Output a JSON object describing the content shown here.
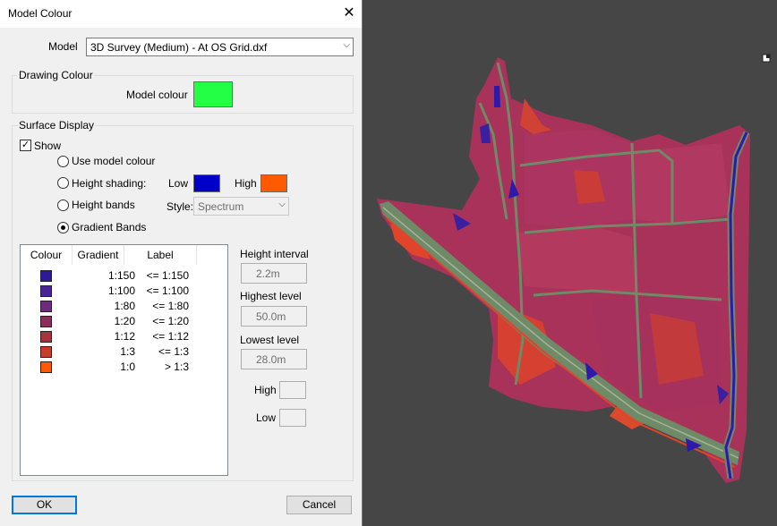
{
  "dialog": {
    "title": "Model Colour",
    "model_label": "Model",
    "model_value": "3D Survey (Medium) - At OS Grid.dxf",
    "drawing_colour": {
      "group_title": "Drawing Colour",
      "model_colour_label": "Model colour",
      "model_colour": "#22ff44"
    },
    "surface_display": {
      "group_title": "Surface Display",
      "show_label": "Show",
      "show_checked": true,
      "options": {
        "use_model_colour": "Use model colour",
        "height_shading": "Height shading:",
        "height_bands": "Height bands",
        "gradient_bands": "Gradient Bands"
      },
      "selected_option": "gradient_bands",
      "low_label": "Low",
      "low_colour": "#0000c8",
      "high_label": "High",
      "high_colour": "#ff5a00",
      "style_label": "Style:",
      "style_value": "Spectrum"
    },
    "gradient_table": {
      "headers": {
        "colour": "Colour",
        "gradient": "Gradient",
        "label": "Label"
      },
      "rows": [
        {
          "colour": "#2e1a96",
          "gradient": "1:150",
          "label": "<= 1:150"
        },
        {
          "colour": "#4a2496",
          "gradient": "1:100",
          "label": "<= 1:100"
        },
        {
          "colour": "#6e2a7c",
          "gradient": "1:80",
          "label": "<= 1:80"
        },
        {
          "colour": "#8c2e5c",
          "gradient": "1:20",
          "label": "<= 1:20"
        },
        {
          "colour": "#a8323e",
          "gradient": "1:12",
          "label": "<= 1:12"
        },
        {
          "colour": "#c83c2a",
          "gradient": "1:3",
          "label": "<= 1:3"
        },
        {
          "colour": "#ff5a00",
          "gradient": "1:0",
          "label": "> 1:3"
        }
      ]
    },
    "height_interval_label": "Height interval",
    "height_interval_value": "2.2m",
    "highest_level_label": "Highest level",
    "highest_level_value": "50.0m",
    "lowest_level_label": "Lowest level",
    "lowest_level_value": "28.0m",
    "high_label": "High",
    "low_label": "Low",
    "ok_label": "OK",
    "cancel_label": "Cancel"
  },
  "viewport": {
    "background": "#464646",
    "surface_base_colour": "#a8325a",
    "road_colour": "#6e8a66",
    "channel_colour": "#2e1aaa",
    "steep_colour": "#e0442a"
  }
}
